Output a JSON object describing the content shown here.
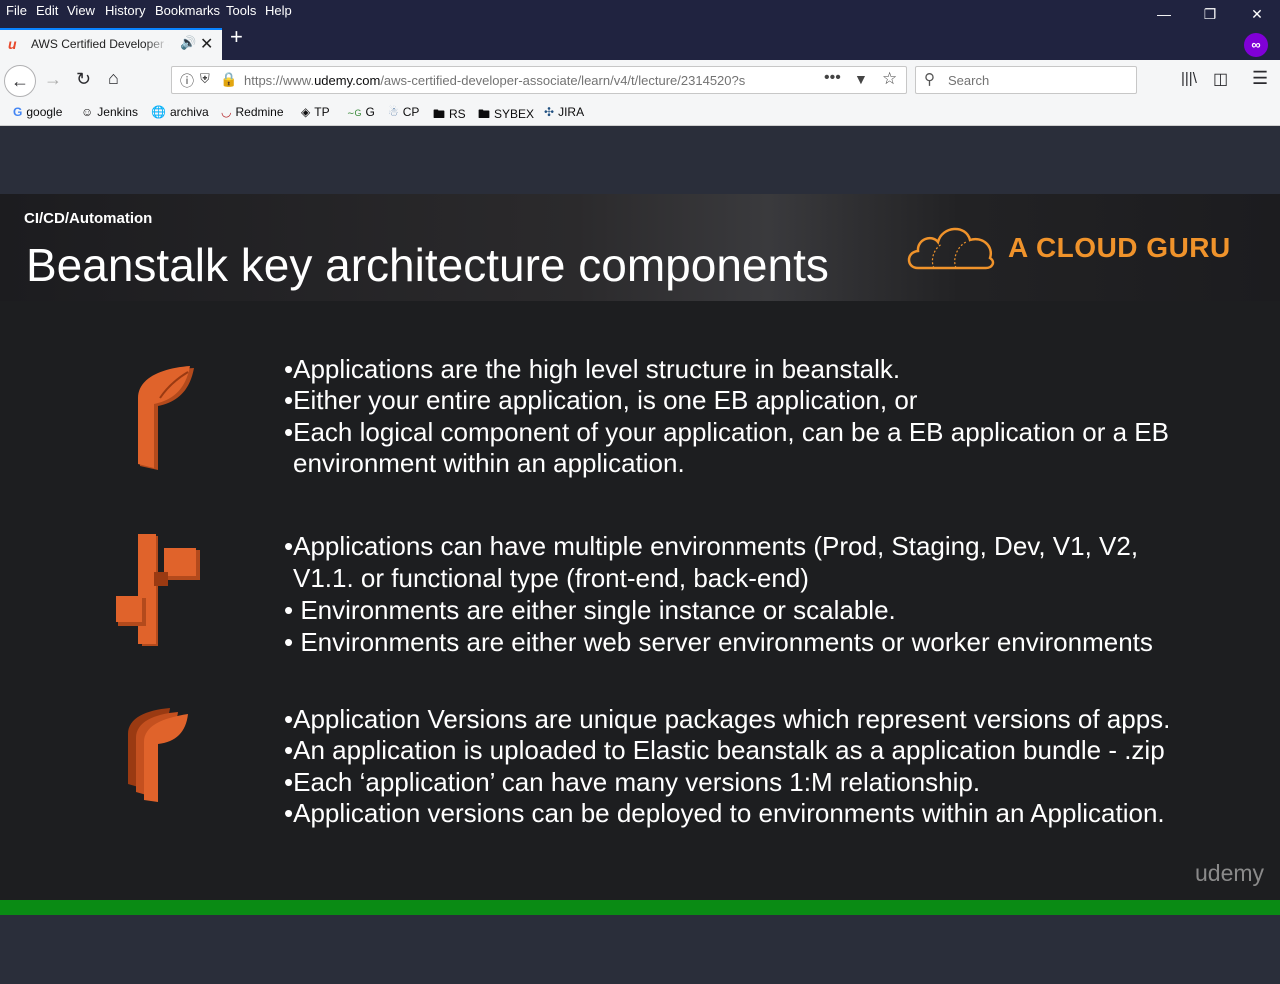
{
  "menubar": {
    "items": [
      "File",
      "Edit",
      "View",
      "History",
      "Bookmarks",
      "Tools",
      "Help"
    ]
  },
  "tab": {
    "title": "AWS Certified Developer - A",
    "new_tab_label": "+"
  },
  "navbar": {
    "url_prefix": "https://www.",
    "url_host": "udemy.com",
    "url_path": "/aws-certified-developer-associate/learn/v4/t/lecture/2314520?s",
    "search_placeholder": "Search"
  },
  "bookmarks": [
    {
      "label": "google",
      "icon": "google-icon"
    },
    {
      "label": "Jenkins",
      "icon": "jenkins-icon"
    },
    {
      "label": "archiva",
      "icon": "globe-icon"
    },
    {
      "label": "Redmine",
      "icon": "redmine-icon"
    },
    {
      "label": "TP",
      "icon": "diamond-icon"
    },
    {
      "label": "G",
      "icon": "gerrit-icon"
    },
    {
      "label": "CP",
      "icon": "cp-icon"
    },
    {
      "label": "RS",
      "icon": "folder-icon"
    },
    {
      "label": "SYBEX",
      "icon": "folder-icon"
    },
    {
      "label": "JIRA",
      "icon": "jira-icon"
    }
  ],
  "slide": {
    "breadcrumb": "CI/CD/Automation",
    "title": "Beanstalk key architecture components",
    "logo_text": "A CLOUD GURU",
    "sections": [
      {
        "icon": "beanstalk-application-icon",
        "lines": [
          "•Applications are the high level structure in beanstalk.",
          "•Either your entire application, is one EB application, or",
          "•Each logical component of your application, can be a EB application or a EB",
          " environment within an application."
        ]
      },
      {
        "icon": "beanstalk-environment-icon",
        "lines": [
          "•Applications can have multiple environments (Prod, Staging, Dev, V1, V2,",
          " V1.1. or functional type (front-end, back-end)",
          "• Environments are either single instance or scalable.",
          "• Environments are either web server environments or worker environments"
        ]
      },
      {
        "icon": "beanstalk-versions-icon",
        "lines": [
          "•Application Versions are unique packages which represent versions of apps.",
          "•An application is uploaded to Elastic beanstalk as a application bundle - .zip",
          "•Each ‘application’ can have many versions 1:M relationship.",
          "•Application versions can be deployed to environments within an Application."
        ]
      }
    ],
    "watermark": "udemy"
  },
  "colors": {
    "accent": "#f0932b",
    "progress": "#0a8b14",
    "chrome": "#202340",
    "aws_orange": "#e0632b"
  }
}
